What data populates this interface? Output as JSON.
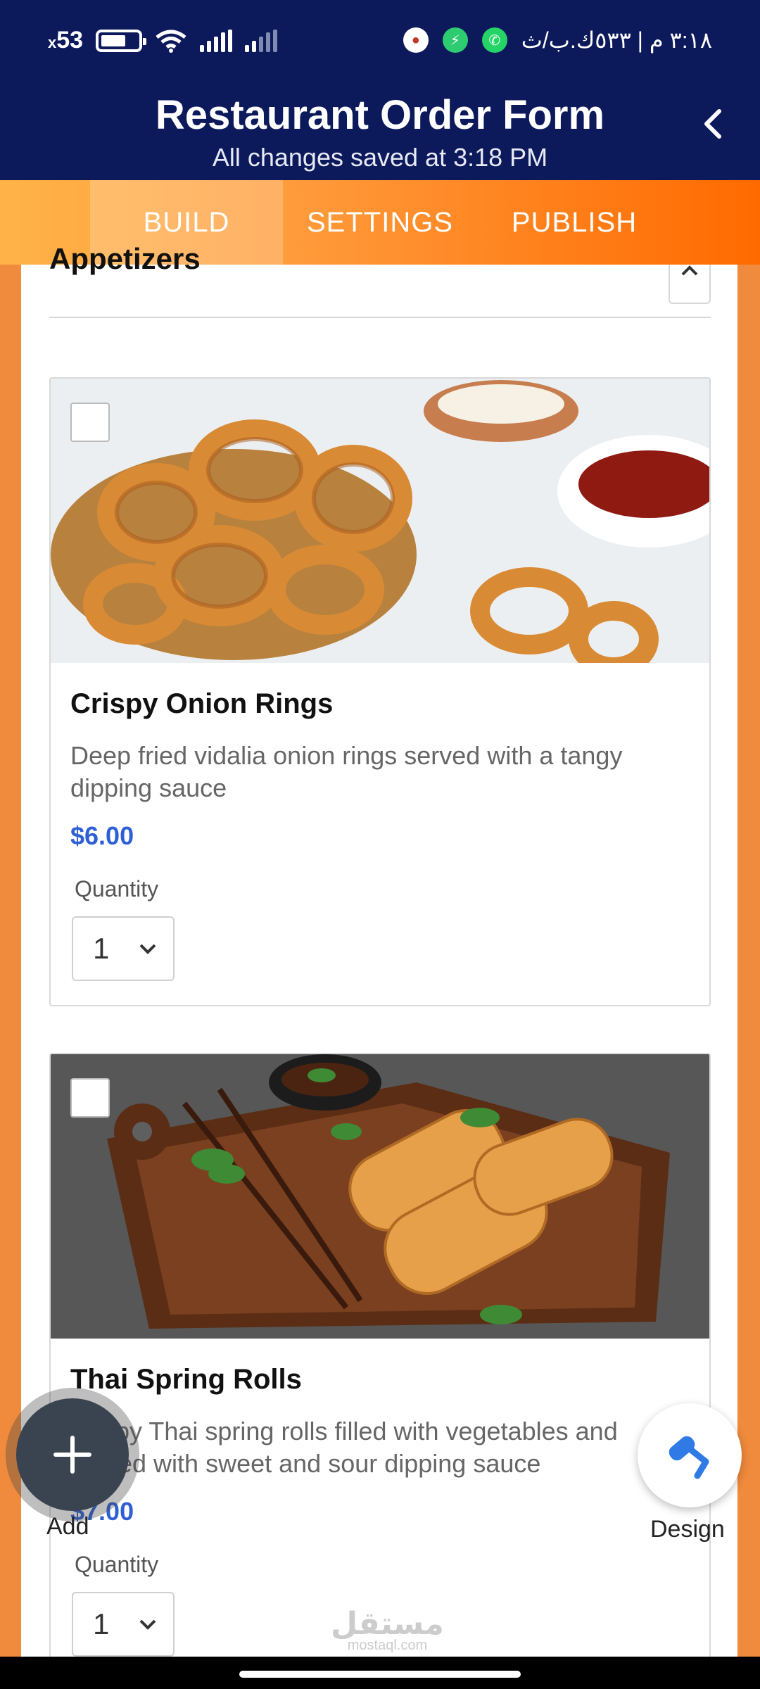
{
  "status_bar": {
    "left_text": "53",
    "left_prefix": "x",
    "right_text": "٣:١٨ م | ٥٣٣ك.ب/ث"
  },
  "header": {
    "title": "Restaurant Order Form",
    "subtitle": "All changes saved at 3:18 PM"
  },
  "tabs": [
    {
      "label": "BUILD",
      "active": true
    },
    {
      "label": "SETTINGS",
      "active": false
    },
    {
      "label": "PUBLISH",
      "active": false
    }
  ],
  "section": {
    "title": "Appetizers"
  },
  "items": [
    {
      "name": "Crispy Onion Rings",
      "description": "Deep fried vidalia onion rings served with a tangy dipping sauce",
      "price": "$6.00",
      "quantity_label": "Quantity",
      "quantity_value": "1"
    },
    {
      "name": "Thai Spring Rolls",
      "description": "Crispy Thai spring rolls filled with vegetables and served with sweet and sour dipping sauce",
      "price": "$7.00",
      "quantity_label": "Quantity",
      "quantity_value": "1"
    }
  ],
  "fab": {
    "add_label": "Add",
    "design_label": "Design"
  },
  "watermark": {
    "arabic": "مستقل",
    "latin": "mostaql.com"
  },
  "colors": {
    "header_bg": "#0c1a5c",
    "tab_gradient_start": "#ffb347",
    "tab_gradient_end": "#ff6a00",
    "page_bg": "#f08a3c",
    "price": "#2f5fd4"
  }
}
